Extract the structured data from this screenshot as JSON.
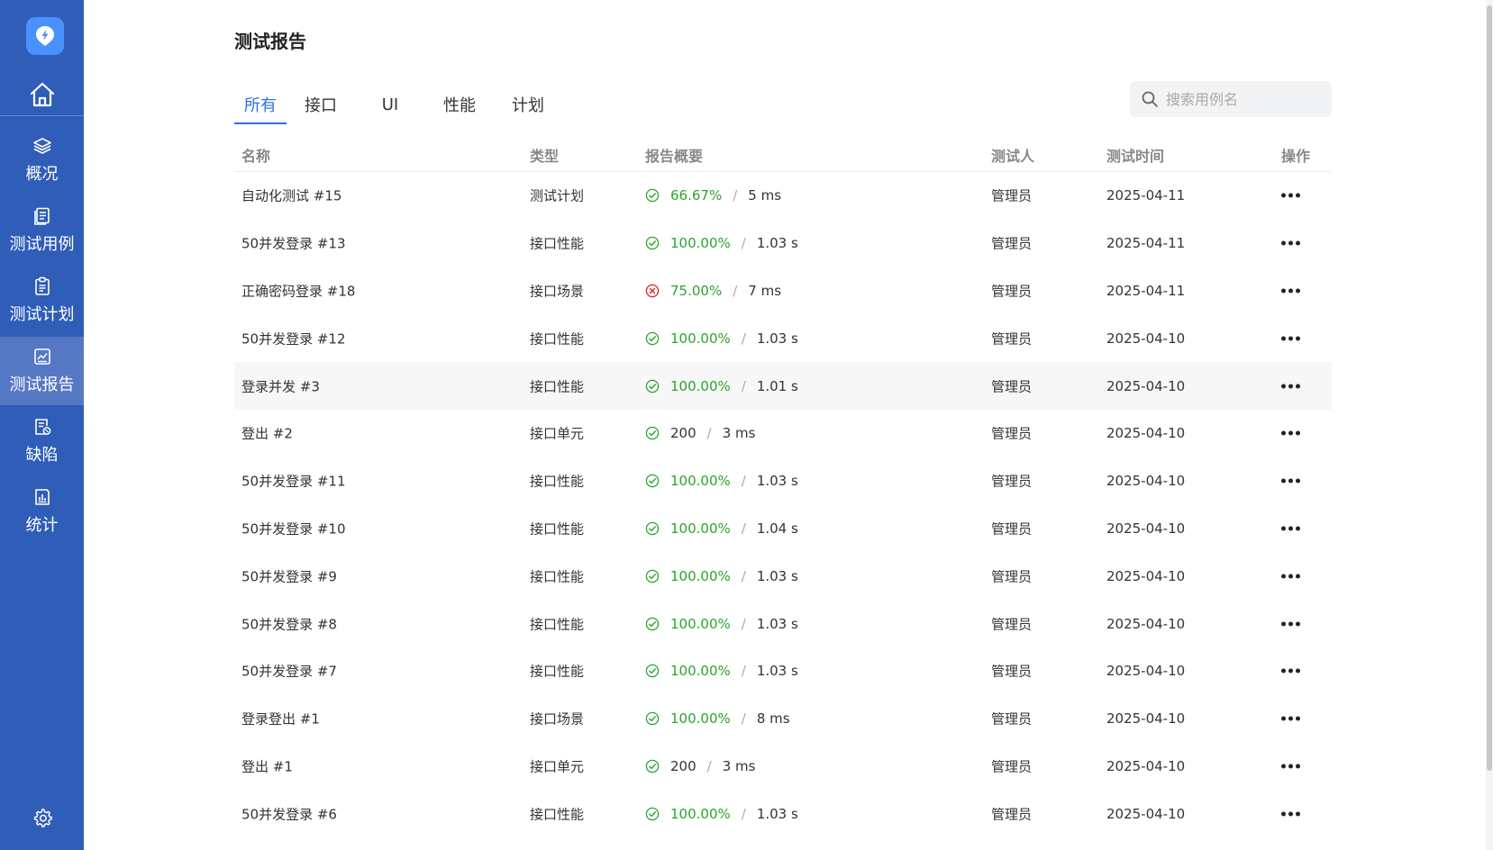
{
  "sidebar": {
    "items": [
      {
        "label": "概况",
        "icon": "layers-icon"
      },
      {
        "label": "测试用例",
        "icon": "document-list-icon"
      },
      {
        "label": "测试计划",
        "icon": "clipboard-icon"
      },
      {
        "label": "测试报告",
        "icon": "report-chart-icon",
        "active": true
      },
      {
        "label": "缺陷",
        "icon": "bug-document-icon"
      },
      {
        "label": "统计",
        "icon": "bar-chart-icon"
      }
    ]
  },
  "page": {
    "title": "测试报告"
  },
  "tabs": [
    {
      "label": "所有",
      "active": true
    },
    {
      "label": "接口"
    },
    {
      "label": "UI"
    },
    {
      "label": "性能"
    },
    {
      "label": "计划"
    }
  ],
  "search": {
    "placeholder": "搜索用例名"
  },
  "table": {
    "headers": [
      "名称",
      "类型",
      "报告概要",
      "测试人",
      "测试时间",
      "操作"
    ],
    "rows": [
      {
        "name": "自动化测试 #15",
        "type": "测试计划",
        "status": "success",
        "rate": "66.67%",
        "duration": "5 ms",
        "tester": "管理员",
        "time": "2025-04-11"
      },
      {
        "name": "50并发登录 #13",
        "type": "接口性能",
        "status": "success",
        "rate": "100.00%",
        "duration": "1.03 s",
        "tester": "管理员",
        "time": "2025-04-11"
      },
      {
        "name": "正确密码登录 #18",
        "type": "接口场景",
        "status": "error",
        "rate": "75.00%",
        "duration": "7 ms",
        "tester": "管理员",
        "time": "2025-04-11"
      },
      {
        "name": "50并发登录 #12",
        "type": "接口性能",
        "status": "success",
        "rate": "100.00%",
        "duration": "1.03 s",
        "tester": "管理员",
        "time": "2025-04-10"
      },
      {
        "name": "登录并发 #3",
        "type": "接口性能",
        "status": "success",
        "rate": "100.00%",
        "duration": "1.01 s",
        "tester": "管理员",
        "time": "2025-04-10",
        "hover": true
      },
      {
        "name": "登出 #2",
        "type": "接口单元",
        "status": "success",
        "rate": "200",
        "duration": "3 ms",
        "tester": "管理员",
        "time": "2025-04-10",
        "plain": true
      },
      {
        "name": "50并发登录 #11",
        "type": "接口性能",
        "status": "success",
        "rate": "100.00%",
        "duration": "1.03 s",
        "tester": "管理员",
        "time": "2025-04-10"
      },
      {
        "name": "50并发登录 #10",
        "type": "接口性能",
        "status": "success",
        "rate": "100.00%",
        "duration": "1.04 s",
        "tester": "管理员",
        "time": "2025-04-10"
      },
      {
        "name": "50并发登录 #9",
        "type": "接口性能",
        "status": "success",
        "rate": "100.00%",
        "duration": "1.03 s",
        "tester": "管理员",
        "time": "2025-04-10"
      },
      {
        "name": "50并发登录 #8",
        "type": "接口性能",
        "status": "success",
        "rate": "100.00%",
        "duration": "1.03 s",
        "tester": "管理员",
        "time": "2025-04-10"
      },
      {
        "name": "50并发登录 #7",
        "type": "接口性能",
        "status": "success",
        "rate": "100.00%",
        "duration": "1.03 s",
        "tester": "管理员",
        "time": "2025-04-10"
      },
      {
        "name": "登录登出 #1",
        "type": "接口场景",
        "status": "success",
        "rate": "100.00%",
        "duration": "8 ms",
        "tester": "管理员",
        "time": "2025-04-10"
      },
      {
        "name": "登出 #1",
        "type": "接口单元",
        "status": "success",
        "rate": "200",
        "duration": "3 ms",
        "tester": "管理员",
        "time": "2025-04-10",
        "plain": true
      },
      {
        "name": "50并发登录 #6",
        "type": "接口性能",
        "status": "success",
        "rate": "100.00%",
        "duration": "1.03 s",
        "tester": "管理员",
        "time": "2025-04-10"
      }
    ]
  },
  "colors": {
    "sidebar": "#2f5db7",
    "accent": "#2f6fde",
    "success": "#2aa52a",
    "error": "#e02020"
  }
}
